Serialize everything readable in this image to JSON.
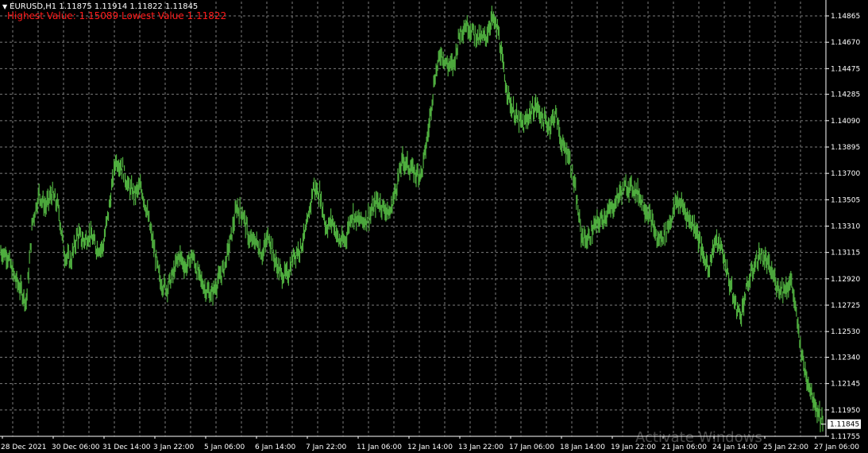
{
  "header": {
    "symbol_line": "EURUSD,H1  1.11875 1.11914 1.11822 1.11845",
    "highlow_line": "Highest Value: 1.15089 Lowest Value 1.11822"
  },
  "watermark": "Activate Windows",
  "colors": {
    "background": "#000000",
    "candles": "#4fae3f",
    "grid": "#7c7c7c",
    "axis": "#ffffff",
    "highlow": "#ff1a1a"
  },
  "chart_data": {
    "type": "line",
    "title": "EURUSD,H1",
    "ylim": [
      1.11755,
      1.14865
    ],
    "y_ticks": [
      "1.14865",
      "1.14670",
      "1.14475",
      "1.14285",
      "1.14090",
      "1.13895",
      "1.13700",
      "1.13505",
      "1.13310",
      "1.13115",
      "1.12920",
      "1.12725",
      "1.12530",
      "1.12340",
      "1.12145",
      "1.11950",
      "1.11755"
    ],
    "x_ticks": [
      "28 Dec 2021",
      "30 Dec 06:00",
      "31 Dec 14:00",
      "3 Jan 22:00",
      "5 Jan 06:00",
      "6 Jan 14:00",
      "7 Jan 22:00",
      "11 Jan 06:00",
      "12 Jan 14:00",
      "13 Jan 22:00",
      "17 Jan 06:00",
      "18 Jan 14:00",
      "19 Jan 22:00",
      "21 Jan 06:00",
      "24 Jan 14:00",
      "25 Jan 22:00",
      "27 Jan 06:00"
    ],
    "current_price": "1.11845",
    "grid": true,
    "series": [
      {
        "values": [
          1.1312,
          1.131,
          1.1295,
          1.1285,
          1.1275,
          1.1335,
          1.1355,
          1.1345,
          1.1355,
          1.1345,
          1.131,
          1.1305,
          1.1325,
          1.132,
          1.1325,
          1.1315,
          1.1315,
          1.1345,
          1.138,
          1.1375,
          1.136,
          1.1355,
          1.136,
          1.134,
          1.1315,
          1.129,
          1.1285,
          1.1295,
          1.131,
          1.13,
          1.131,
          1.1295,
          1.1285,
          1.128,
          1.129,
          1.13,
          1.132,
          1.1345,
          1.134,
          1.132,
          1.132,
          1.131,
          1.1325,
          1.1305,
          1.1295,
          1.1295,
          1.131,
          1.1315,
          1.133,
          1.136,
          1.1355,
          1.133,
          1.1335,
          1.132,
          1.132,
          1.134,
          1.1335,
          1.1335,
          1.134,
          1.135,
          1.1345,
          1.134,
          1.136,
          1.138,
          1.1375,
          1.137,
          1.137,
          1.14,
          1.144,
          1.146,
          1.145,
          1.145,
          1.1475,
          1.148,
          1.1475,
          1.147,
          1.147,
          1.1485,
          1.1475,
          1.144,
          1.142,
          1.141,
          1.1405,
          1.1415,
          1.142,
          1.141,
          1.1405,
          1.1415,
          1.139,
          1.1385,
          1.136,
          1.1325,
          1.132,
          1.133,
          1.1335,
          1.134,
          1.1345,
          1.1355,
          1.136,
          1.136,
          1.1355,
          1.1345,
          1.1335,
          1.132,
          1.1325,
          1.1335,
          1.135,
          1.1345,
          1.1335,
          1.133,
          1.131,
          1.13,
          1.132,
          1.1315,
          1.1295,
          1.1275,
          1.1265,
          1.1285,
          1.13,
          1.131,
          1.1305,
          1.1295,
          1.1285,
          1.1285,
          1.129,
          1.1255,
          1.1225,
          1.121,
          1.1195,
          1.1185
        ]
      }
    ]
  }
}
